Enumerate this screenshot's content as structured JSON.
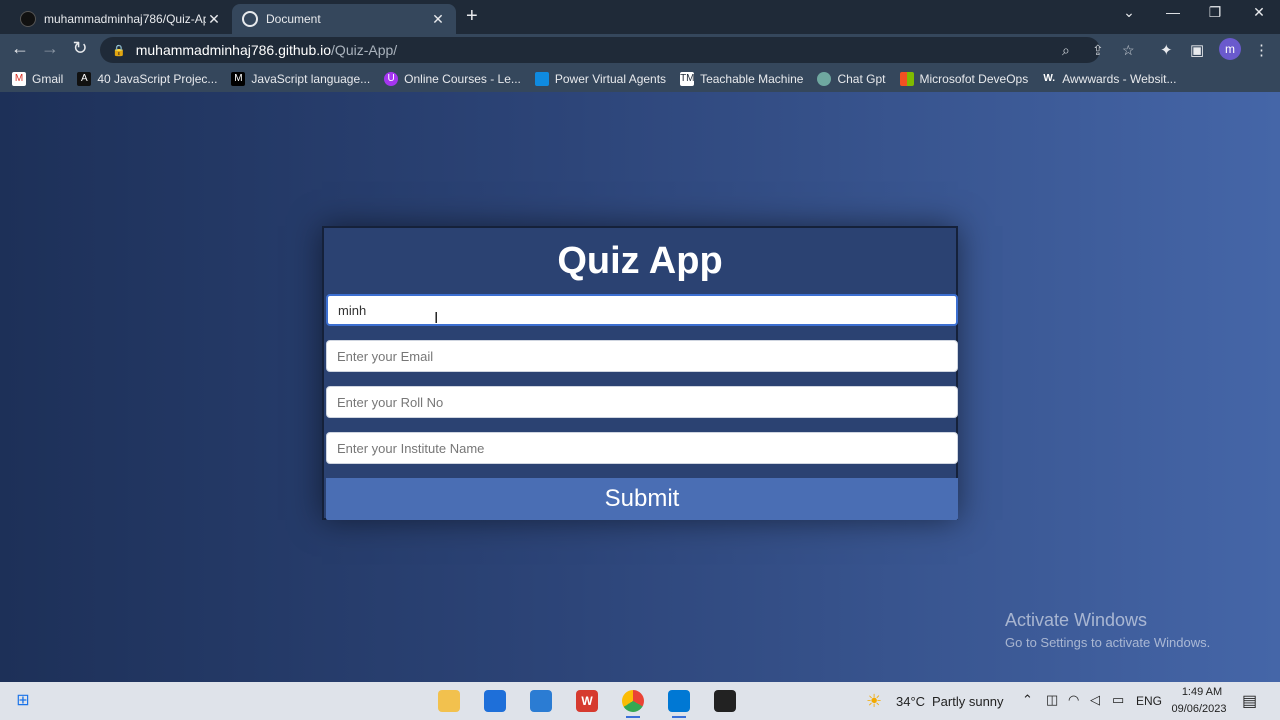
{
  "browser": {
    "tabs": [
      {
        "title": "muhammadminhaj786/Quiz-App",
        "active": false
      },
      {
        "title": "Document",
        "active": true
      }
    ],
    "url_host": "muhammadminhaj786.github.io",
    "url_path": "/Quiz-App/",
    "profile_initial": "m",
    "bookmarks": [
      {
        "label": "Gmail",
        "icon": "gmail-icon"
      },
      {
        "label": "40 JavaScript Projec...",
        "icon": "abstract-icon"
      },
      {
        "label": "JavaScript language...",
        "icon": "m-icon"
      },
      {
        "label": "Online Courses - Le...",
        "icon": "udemy-icon"
      },
      {
        "label": "Power Virtual Agents",
        "icon": "pva-icon"
      },
      {
        "label": "Teachable Machine",
        "icon": "tm-icon"
      },
      {
        "label": "Chat Gpt",
        "icon": "chatgpt-icon"
      },
      {
        "label": "Microsofot DeveOps",
        "icon": "microsoft-icon"
      },
      {
        "label": "Awwwards - Websit...",
        "icon": "w-icon"
      }
    ]
  },
  "quiz": {
    "title": "Quiz App",
    "name_value": "minh",
    "email_placeholder": "Enter your Email",
    "roll_placeholder": "Enter your Roll No",
    "institute_placeholder": "Enter your Institute Name",
    "submit_label": "Submit"
  },
  "watermark": {
    "line1": "Activate Windows",
    "line2": "Go to Settings to activate Windows."
  },
  "taskbar": {
    "weather_temp": "34°C",
    "weather_desc": "Partly sunny",
    "lang": "ENG",
    "time": "1:49 AM",
    "date": "09/06/2023"
  }
}
